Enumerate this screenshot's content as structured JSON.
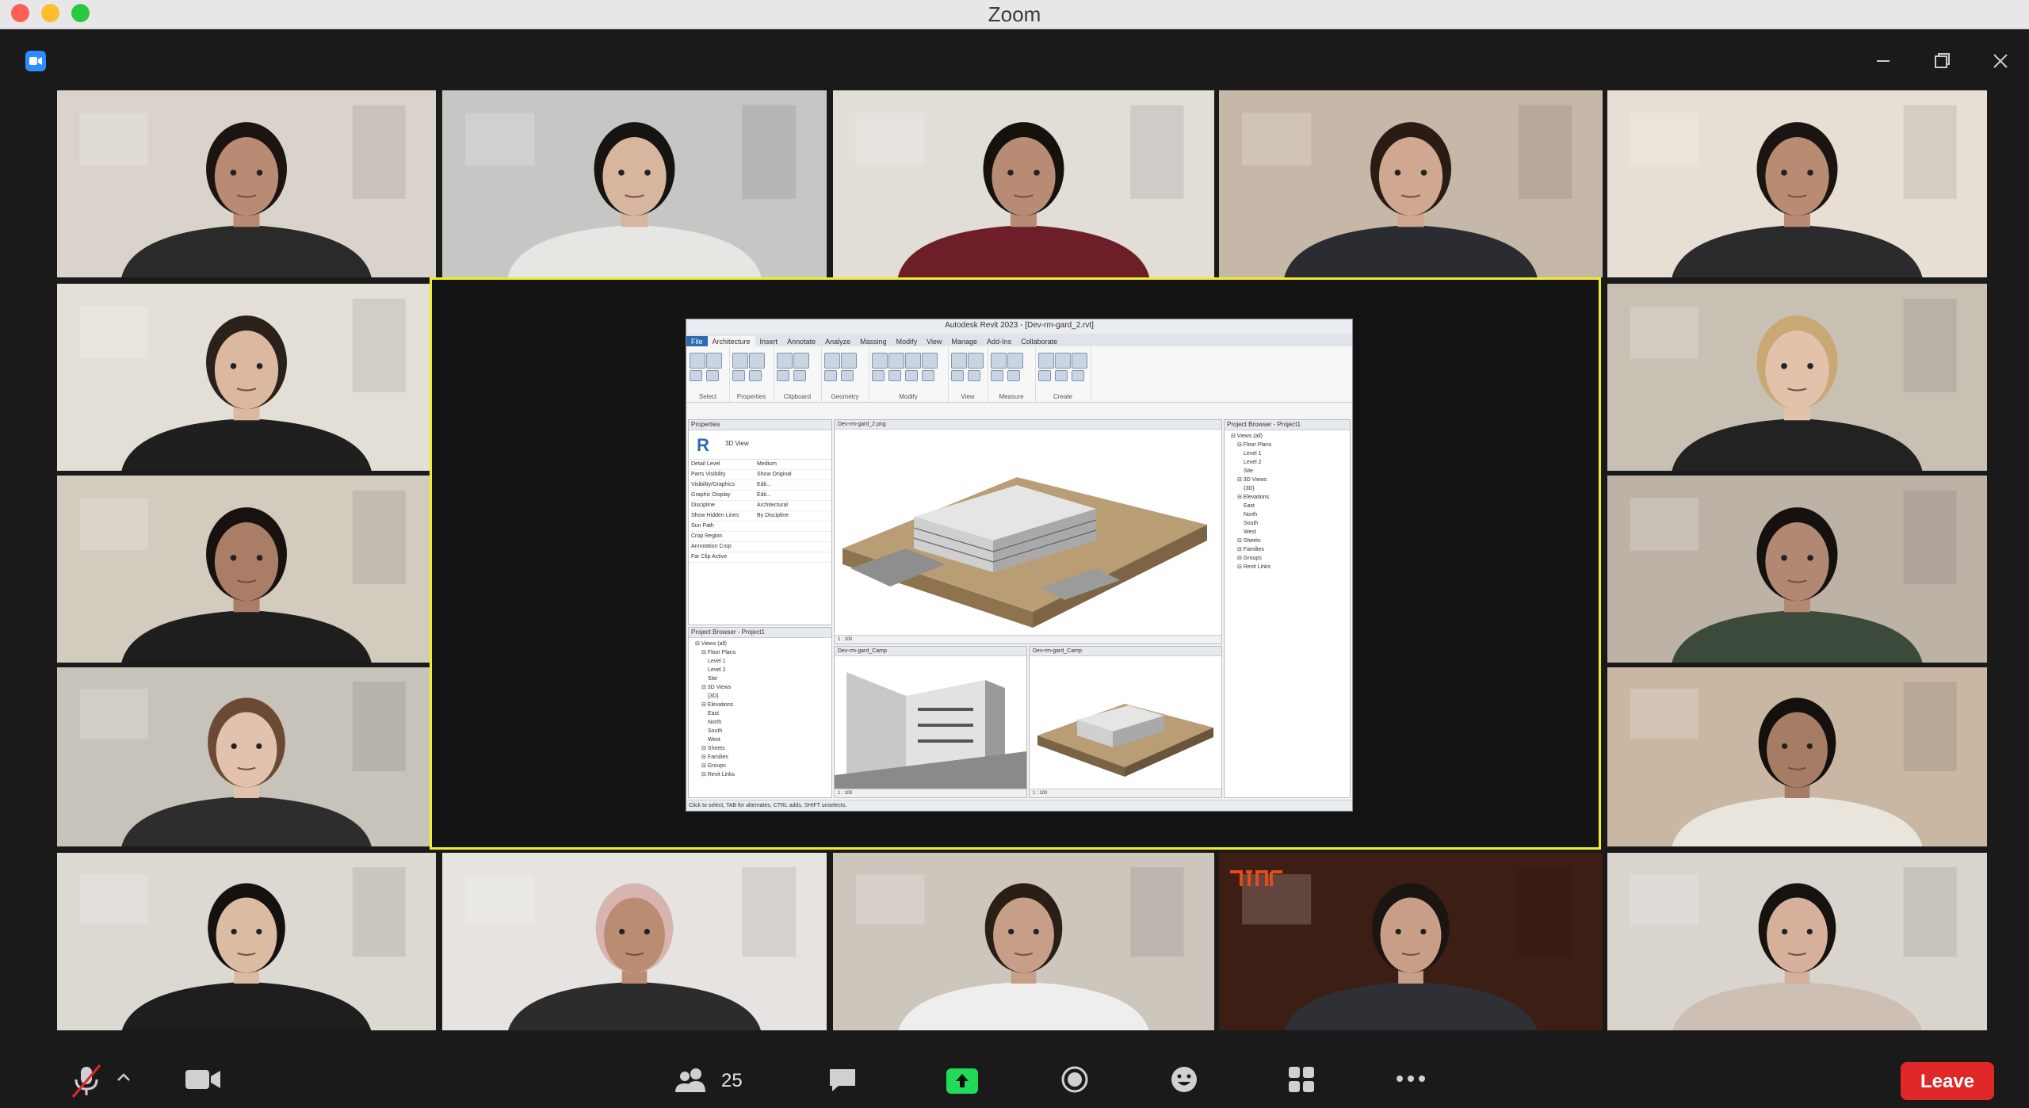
{
  "window": {
    "title": "Zoom"
  },
  "video_tiles": [
    {
      "id": "r1c1",
      "wall": "#d9d3cb",
      "shirt": "#2a2a2a",
      "skin": "#b98a74",
      "hair": "#1c1410"
    },
    {
      "id": "r1c2",
      "wall": "#c6c7c4",
      "shirt": "#e6e6e2",
      "skin": "#d7b59e",
      "hair": "#161311"
    },
    {
      "id": "r1c3",
      "wall": "#e1ddd7",
      "shirt": "#6e1e28",
      "skin": "#b88b74",
      "hair": "#17110e"
    },
    {
      "id": "r1c4",
      "wall": "#c6b8a8",
      "shirt": "#2a2c32",
      "skin": "#d0a791",
      "hair": "#2a1c14"
    },
    {
      "id": "r1c5",
      "wall": "#e7dfd4",
      "shirt": "#2b2b2d",
      "skin": "#b98b72",
      "hair": "#1a1512"
    },
    {
      "id": "r2c1",
      "wall": "#e4dfd6",
      "shirt": "#1f1f1f",
      "skin": "#dcb8a1",
      "hair": "#2b211b"
    },
    {
      "id": "r2c5",
      "wall": "#c9c0b4",
      "shirt": "#222222",
      "skin": "#e3c2ac",
      "hair": "#c9a874"
    },
    {
      "id": "r3c1",
      "wall": "#d4cbbf",
      "shirt": "#1e1e1e",
      "skin": "#a97d66",
      "hair": "#17120f"
    },
    {
      "id": "r3c5",
      "wall": "#bdb2a6",
      "shirt": "#3b4a3a",
      "skin": "#b28873",
      "hair": "#15110e"
    },
    {
      "id": "r4c1",
      "wall": "#c7c3bb",
      "shirt": "#2d2d2d",
      "skin": "#e2c2ad",
      "hair": "#6a4a34"
    },
    {
      "id": "r4c5",
      "wall": "#c9b7a4",
      "shirt": "#e9e5dc",
      "skin": "#a77c64",
      "hair": "#14100d"
    },
    {
      "id": "r5c1",
      "wall": "#dcd8d2",
      "shirt": "#1e1e1e",
      "skin": "#dcbba3",
      "hair": "#141110"
    },
    {
      "id": "r5c2",
      "wall": "#e6e3e0",
      "shirt": "#2c2c2c",
      "skin": "#ba8d72",
      "hair": "#d8b4b0"
    },
    {
      "id": "r5c3",
      "wall": "#cdc6bd",
      "shirt": "#eeeeec",
      "skin": "#c79f88",
      "hair": "#2a1e17"
    },
    {
      "id": "r5c4",
      "wall": "#3d1e14",
      "shirt": "#2f3036",
      "skin": "#c89f86",
      "hair": "#1b1512"
    },
    {
      "id": "r5c5",
      "wall": "#d9d4cd",
      "shirt": "#cdbfb3",
      "skin": "#d6b09a",
      "hair": "#161210"
    }
  ],
  "shared_screen": {
    "app_title": "Autodesk Revit 2023 - [Dev-rm-gard_2.rvt]",
    "tabs": [
      "File",
      "Architecture",
      "Insert",
      "Annotate",
      "Analyze",
      "Massing",
      "Modify",
      "View",
      "Manage",
      "Add-Ins",
      "Collaborate"
    ],
    "ribbon_groups": [
      "Select",
      "Properties",
      "Clipboard",
      "Geometry",
      "Modify",
      "View",
      "Measure",
      "Create"
    ],
    "properties_header": "Properties",
    "properties_type": "3D View",
    "properties_rows": [
      {
        "k": "Detail Level",
        "v": "Medium"
      },
      {
        "k": "Parts Visibility",
        "v": "Show Original"
      },
      {
        "k": "Visibility/Graphics",
        "v": "Edit..."
      },
      {
        "k": "Graphic Display",
        "v": "Edit..."
      },
      {
        "k": "Discipline",
        "v": "Architectural"
      },
      {
        "k": "Show Hidden Lines",
        "v": "By Discipline"
      },
      {
        "k": "Sun Path",
        "v": ""
      },
      {
        "k": "Crop Region",
        "v": ""
      },
      {
        "k": "Annotation Crop",
        "v": ""
      },
      {
        "k": "Far Clip Active",
        "v": ""
      }
    ],
    "browser_header": "Project Browser - Project1",
    "browser_items": [
      "Views (all)",
      "Floor Plans",
      "Level 1",
      "Level 2",
      "Site",
      "3D Views",
      "{3D}",
      "Elevations",
      "East",
      "North",
      "South",
      "West",
      "Sheets",
      "Families",
      "Groups",
      "Revit Links"
    ],
    "view_main": "Dev-rm-gard_2.png",
    "view_left": "Dev-rm-gard_Camp",
    "view_right": "Dev-rm-gard_Camp",
    "scale_main": "1 : 100",
    "scale_small_a": "1 : 100",
    "scale_small_b": "1 : 100",
    "status": "Click to select, TAB for alternates, CTRL adds, SHIFT unselects."
  },
  "toolbar": {
    "participants_count": "25",
    "leave_label": "Leave"
  }
}
